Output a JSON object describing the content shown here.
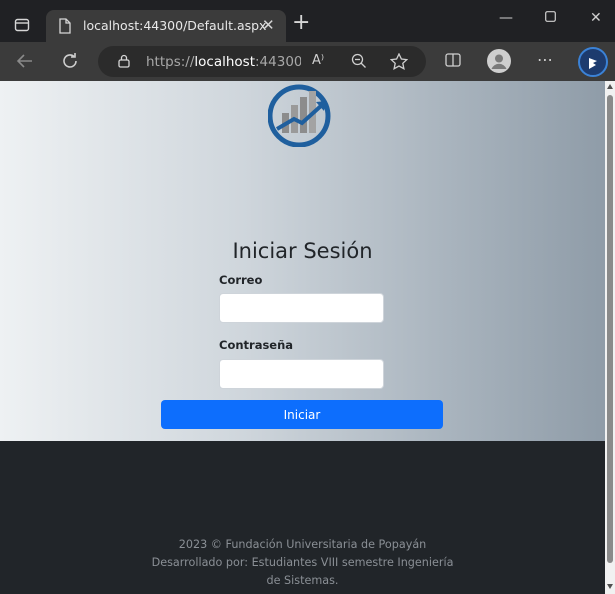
{
  "browser": {
    "tab_title": "localhost:44300/Default.aspx",
    "url_scheme": "https://",
    "url_host": "localhost",
    "url_rest": ":44300...",
    "icons": [
      "tab-actions-icon",
      "page-icon",
      "close-icon",
      "new-tab-icon",
      "minimize-icon",
      "maximize-icon",
      "window-close-icon",
      "back-icon",
      "refresh-icon",
      "lock-icon",
      "read-aloud-icon",
      "zoom-out-icon",
      "favorite-star-icon",
      "split-screen-icon",
      "profile-icon",
      "more-icon",
      "bing-icon"
    ],
    "read_aloud_glyph": "A⁾",
    "more_glyph": "⋯"
  },
  "login": {
    "title": "Iniciar Sesión",
    "email_label": "Correo",
    "email_value": "",
    "password_label": "Contraseña",
    "password_value": "",
    "submit_label": "Iniciar"
  },
  "footer": {
    "line1": "2023 © Fundación Universitaria de Popayán",
    "line2": "Desarrollado por: Estudiantes VIII semestre Ingeniería",
    "line3": "de Sistemas."
  },
  "colors": {
    "primary": "#0d6efd",
    "footer_bg": "#212529",
    "logo_blue": "#1f5f9e"
  }
}
